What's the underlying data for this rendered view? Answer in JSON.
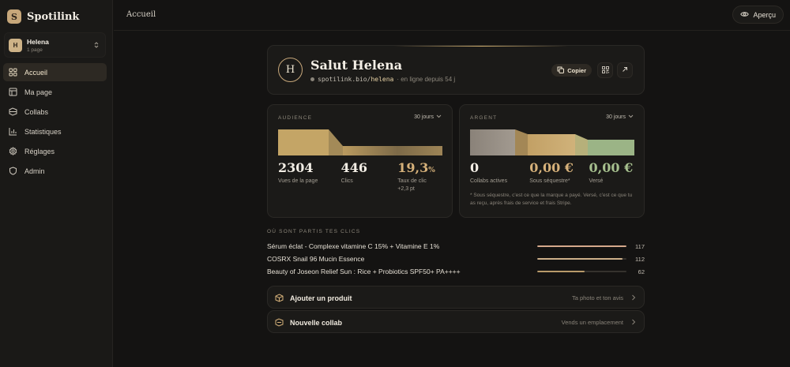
{
  "brand": {
    "logo_letter": "S",
    "name": "Spotilink"
  },
  "account": {
    "avatar_letter": "H",
    "name": "Helena",
    "pages": "1 page"
  },
  "nav": {
    "items": [
      {
        "label": "Accueil",
        "icon": "home-grid-icon",
        "active": true
      },
      {
        "label": "Ma page",
        "icon": "page-layout-icon",
        "active": false
      },
      {
        "label": "Collabs",
        "icon": "tag-icon",
        "active": false
      },
      {
        "label": "Statistiques",
        "icon": "bar-chart-icon",
        "active": false
      },
      {
        "label": "Réglages",
        "icon": "gear-icon",
        "active": false
      },
      {
        "label": "Admin",
        "icon": "shield-icon",
        "active": false
      }
    ]
  },
  "topbar": {
    "breadcrumb": "Accueil",
    "preview_label": "Aperçu"
  },
  "profile": {
    "avatar_letter": "H",
    "greeting": "Salut Helena",
    "url_prefix": "spotilink.bio/",
    "url_handle": "helena",
    "status": "· en ligne depuis 54 j",
    "copy_label": "Copier"
  },
  "audience": {
    "label": "AUDIENCE",
    "period": "30 jours",
    "views": "2304",
    "views_label": "Vues de la page",
    "clicks": "446",
    "clicks_label": "Clics",
    "rate": "19,3",
    "rate_unit": "%",
    "rate_label": "Taux de clic +2,3 pt"
  },
  "money": {
    "label": "ARGENT",
    "period": "30 jours",
    "collabs": "0",
    "collabs_label": "Collabs actives",
    "sequestered": "0,00 €",
    "sequestered_label": "Sous séquestre*",
    "paid": "0,00 €",
    "paid_label": "Versé",
    "footnote": "* Sous séquestre, c'est ce que la marque a payé. Versé, c'est ce que tu as reçu, après frais de service et frais Stripe."
  },
  "clicks_section": {
    "title": "OÙ SONT PARTIS TES CLICS",
    "items": [
      {
        "name": "Sérum éclat - Complexe vitamine C 15% + Vitamine E 1%",
        "count": "117",
        "fraction": 1.0,
        "color": "#d6a98c"
      },
      {
        "name": "COSRX Snail 96 Mucin Essence",
        "count": "112",
        "fraction": 0.96,
        "color": "#cdb08a"
      },
      {
        "name": "Beauty of Joseon Relief Sun : Rice + Probiotics SPF50+ PA++++",
        "count": "62",
        "fraction": 0.53,
        "color": "#b89a6a"
      }
    ]
  },
  "actions": [
    {
      "title": "Ajouter un produit",
      "hint": "Ta photo et ton avis",
      "icon": "box-icon"
    },
    {
      "title": "Nouvelle collab",
      "hint": "Vends un emplacement",
      "icon": "ticket-icon"
    }
  ],
  "colors": {
    "accent": "#c7a77a",
    "background": "#141312",
    "card": "#1b1a18",
    "green": "#9bb486"
  }
}
